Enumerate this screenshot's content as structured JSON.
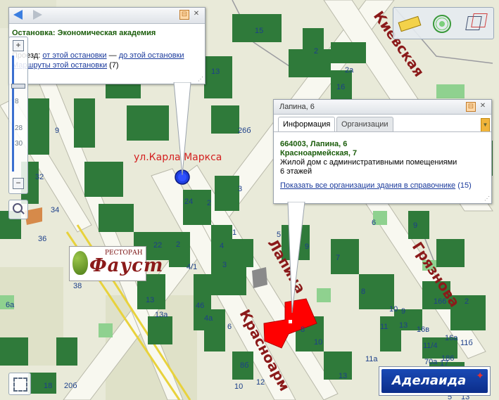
{
  "toolbar": {
    "back_icon": "arrow-left-icon",
    "forward_icon": "arrow-right-icon",
    "ruler_icon": "ruler-icon",
    "radar_icon": "radar-icon",
    "cube_icon": "3d-cube-icon"
  },
  "stop_popup": {
    "title": "Остановка: Экономическая академия",
    "line1_prefix": "Проезд:",
    "line1_link1": "от этой остановки",
    "line1_sep": "—",
    "line1_link2": "до этой остановки",
    "line2_link": "Маршруты этой остановки",
    "line2_count": "(7)"
  },
  "building_popup": {
    "title": "Лапина, 6",
    "tab_info": "Информация",
    "tab_orgs": "Организации",
    "address1": "664003, Лапина, 6",
    "address2": "Красноармейская, 7",
    "desc": "Жилой дом с административными помещениями",
    "floors": "6 этажей",
    "orgs_link": "Показать все организации здания в справочнике",
    "orgs_count": "(15)"
  },
  "zoom": {
    "ticks": [
      "8",
      "28",
      "30"
    ]
  },
  "streets": {
    "karla_marksa": "ул.Карла Маркса",
    "kievskaya": "Киевская",
    "lapina": "Лапина",
    "gryaznova": "Грязнова",
    "krasnoarm": "Красноарм"
  },
  "restaurant": {
    "top": "РЕСТОРАН",
    "name": "Фауст"
  },
  "logo": {
    "text": "Аделаида"
  },
  "house_numbers": [
    "15",
    "2",
    "2а",
    "16",
    "13",
    "26б",
    "9",
    "3",
    "24",
    "2",
    "1",
    "4",
    "3",
    "32",
    "34",
    "36",
    "22",
    "2",
    "4/1",
    "38",
    "13",
    "13а",
    "46",
    "4а",
    "6",
    "5",
    "8",
    "10",
    "9",
    "7",
    "8",
    "10",
    "9",
    "11",
    "13",
    "166",
    "16в",
    "16а",
    "186",
    "11/4",
    "17",
    "11б",
    "11а",
    "70а",
    "6а",
    "8б",
    "10",
    "12",
    "13",
    "9",
    "6",
    "2",
    "15",
    "8",
    "18",
    "20б",
    "5",
    "13"
  ],
  "colors": {
    "building": "#2f7a3a",
    "roof_light": "#55a85a",
    "road": "#f7f7ef",
    "ground": "#e9ead9",
    "target": "#ff0000"
  }
}
